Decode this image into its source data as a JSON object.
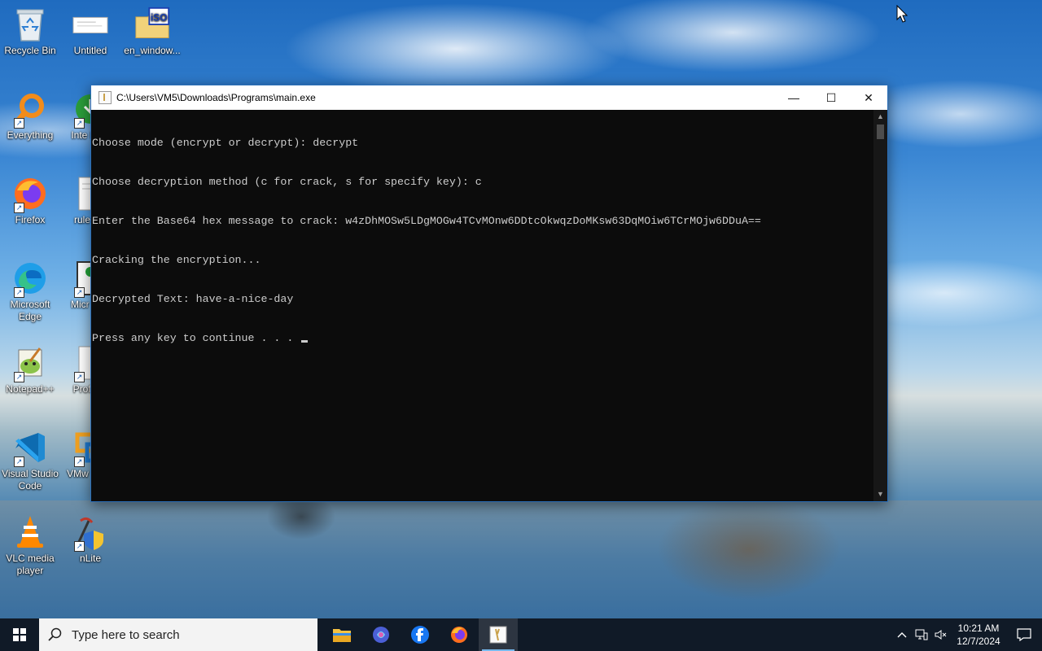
{
  "desktop": {
    "icons": [
      {
        "label": "Recycle Bin",
        "icon": "recycle-bin-icon"
      },
      {
        "label": "Untitled",
        "icon": "document-icon"
      },
      {
        "label": "en_window...",
        "icon": "iso-file-icon"
      },
      {
        "label": "Everything",
        "icon": "search-magnifier-icon"
      },
      {
        "label": "Inte Dow",
        "icon": "internet-download-manager-icon"
      },
      {
        "label": "Firefox",
        "icon": "firefox-icon"
      },
      {
        "label": "rule forl",
        "icon": "text-file-icon"
      },
      {
        "label": "Microsoft Edge",
        "icon": "edge-icon"
      },
      {
        "label": "Micr Rea",
        "icon": "app-icon"
      },
      {
        "label": "Notepad++",
        "icon": "notepad-plus-icon"
      },
      {
        "label": "Profi Ed",
        "icon": "app-icon"
      },
      {
        "label": "Visual Studio Code",
        "icon": "vscode-icon"
      },
      {
        "label": "VMw Work",
        "icon": "vmware-icon"
      },
      {
        "label": "VLC media player",
        "icon": "vlc-icon"
      },
      {
        "label": "nLite",
        "icon": "nlite-icon"
      }
    ]
  },
  "console": {
    "title": "C:\\Users\\VM5\\Downloads\\Programs\\main.exe",
    "lines": [
      "Choose mode (encrypt or decrypt): decrypt",
      "Choose decryption method (c for crack, s for specify key): c",
      "Enter the Base64 hex message to crack: w4zDhMOSw5LDgMOGw4TCvMOnw6DDtcOkwqzDoMKsw63DqMOiw6TCrMOjw6DDuA==",
      "Cracking the encryption...",
      "Decrypted Text: have-a-nice-day",
      "Press any key to continue . . . "
    ],
    "buttons": {
      "minimize": "—",
      "maximize": "☐",
      "close": "✕"
    }
  },
  "taskbar": {
    "search_placeholder": "Type here to search",
    "apps": [
      "file-explorer-icon",
      "copilot-icon",
      "facebook-icon",
      "firefox-icon",
      "console-app-icon"
    ],
    "clock": {
      "time": "10:21 AM",
      "date": "12/7/2024"
    }
  },
  "colors": {
    "console_bg": "#0c0c0c",
    "console_text": "#cccccc",
    "taskbar_bg": "#101a27"
  }
}
